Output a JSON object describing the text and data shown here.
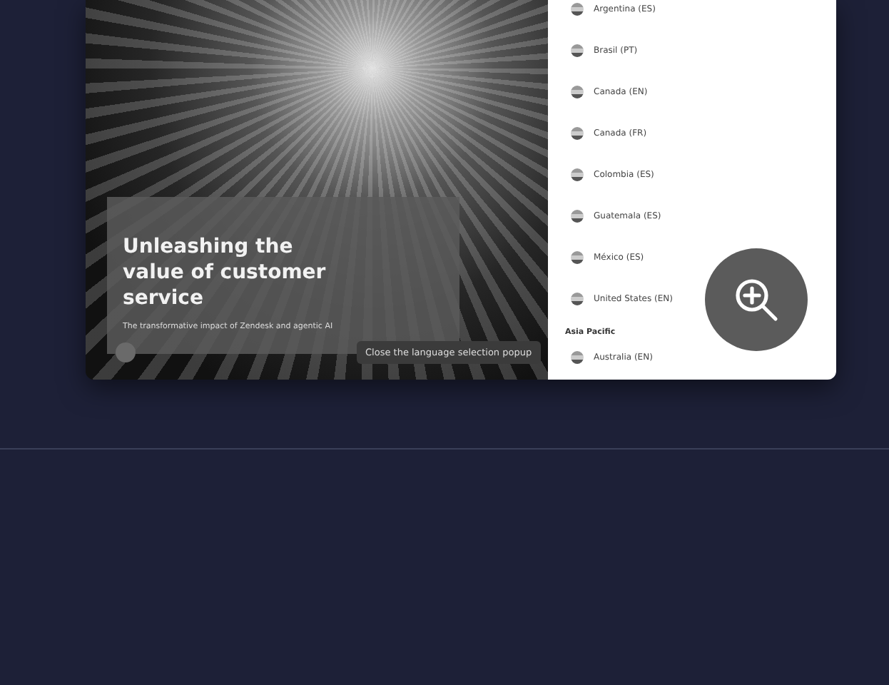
{
  "hero": {
    "title": "Unleashing the value of customer service",
    "subtitle": "The transformative impact of Zendesk and agentic AI"
  },
  "tooltip": "Close the language selection popup",
  "languages": [
    {
      "kind": "item",
      "label": "Argentina (ES)"
    },
    {
      "kind": "item",
      "label": "Brasil (PT)"
    },
    {
      "kind": "item",
      "label": "Canada (EN)"
    },
    {
      "kind": "item",
      "label": "Canada (FR)"
    },
    {
      "kind": "item",
      "label": "Colombia (ES)"
    },
    {
      "kind": "item",
      "label": "Guatemala (ES)"
    },
    {
      "kind": "item",
      "label": "México (ES)"
    },
    {
      "kind": "item",
      "label": "United States (EN)"
    },
    {
      "kind": "heading",
      "label": "Asia Pacific"
    },
    {
      "kind": "item",
      "label": "Australia (EN)"
    }
  ]
}
